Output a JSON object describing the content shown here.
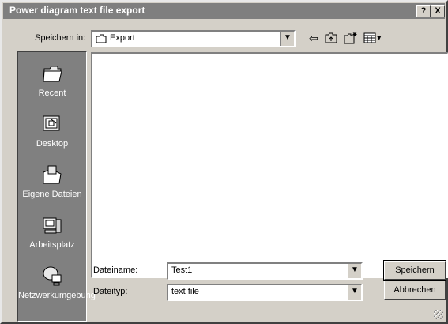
{
  "window": {
    "title": "Power diagram text file export",
    "help_label": "?",
    "close_label": "X"
  },
  "lookin": {
    "label": "Speichern in:",
    "value": "Export"
  },
  "places": [
    {
      "label": "Recent",
      "icon": "folder-recent-icon"
    },
    {
      "label": "Desktop",
      "icon": "desktop-icon"
    },
    {
      "label": "Eigene Dateien",
      "icon": "my-documents-icon"
    },
    {
      "label": "Arbeitsplatz",
      "icon": "my-computer-icon"
    },
    {
      "label": "Netzwerkumgebung",
      "icon": "network-icon"
    }
  ],
  "filename": {
    "label": "Dateiname:",
    "value": "Test1"
  },
  "filetype": {
    "label": "Dateityp:",
    "value": "text file"
  },
  "buttons": {
    "save": "Speichern",
    "cancel": "Abbrechen"
  },
  "glyphs": {
    "dropdown": "▼",
    "back": "⇦",
    "views_dropdown": "▾"
  }
}
